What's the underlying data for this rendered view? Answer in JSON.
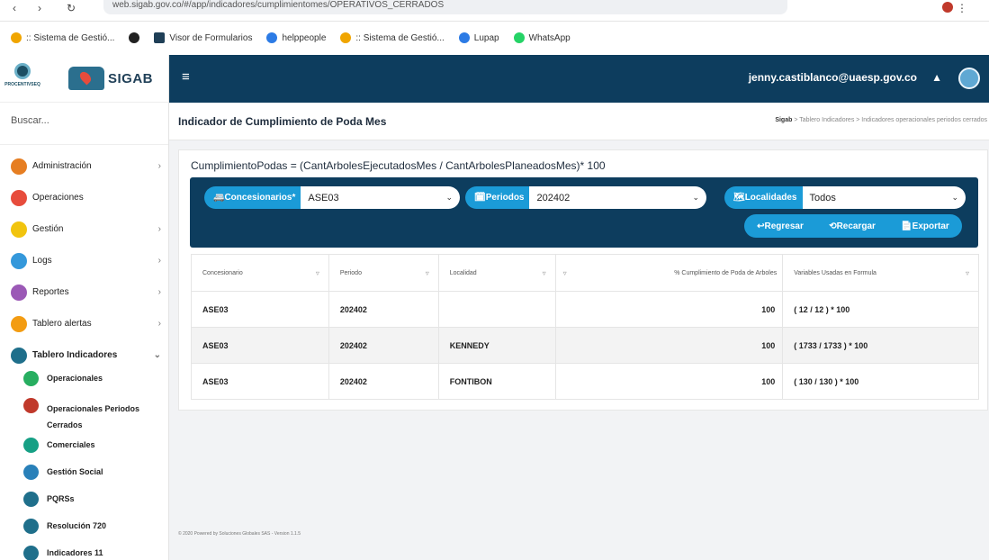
{
  "browser": {
    "url": "web.sigab.gov.co/#/app/indicadores/cumplimientomes/OPERATIVOS_CERRADOS",
    "bookmarks": [
      {
        "label": ":: Sistema de Gestió...",
        "color": "#f0a500"
      },
      {
        "label": "",
        "color": "#222222"
      },
      {
        "label": "Visor de Formularios",
        "color": "#1f3f57"
      },
      {
        "label": "helppeople",
        "color": "#2c7be5"
      },
      {
        "label": ":: Sistema de Gestió...",
        "color": "#f0a500"
      },
      {
        "label": "Lupap",
        "color": "#2c7be5"
      },
      {
        "label": "WhatsApp",
        "color": "#25d366"
      }
    ]
  },
  "brand": {
    "logo_small": "PROCENTIVSEQ",
    "name": "SIGAB"
  },
  "sidebar": {
    "search_placeholder": "Buscar...",
    "items": [
      {
        "label": "Administración",
        "chevron": "›",
        "color": "#e67e22"
      },
      {
        "label": "Operaciones",
        "chevron": "",
        "color": "#e74c3c"
      },
      {
        "label": "Gestión",
        "chevron": "›",
        "color": "#f1c40f"
      },
      {
        "label": "Logs",
        "chevron": "›",
        "color": "#3498db"
      },
      {
        "label": "Reportes",
        "chevron": "›",
        "color": "#9b59b6"
      },
      {
        "label": "Tablero alertas",
        "chevron": "›",
        "color": "#f39c12"
      },
      {
        "label": "Tablero Indicadores",
        "chevron": "⌄",
        "color": "#1f6f8b"
      }
    ],
    "subitems": [
      {
        "label": "Operacionales",
        "color": "#27ae60"
      },
      {
        "label": "Operacionales Periodos Cerrados",
        "color": "#c0392b"
      },
      {
        "label": "Comerciales",
        "color": "#16a085"
      },
      {
        "label": "Gestión Social",
        "color": "#2980b9"
      },
      {
        "label": "PQRSs",
        "color": "#1f6f8b"
      },
      {
        "label": "Resolución 720",
        "color": "#1f6f8b"
      },
      {
        "label": "Indicadores 11",
        "color": "#1f6f8b"
      }
    ]
  },
  "topbar": {
    "menu_icon": "≡",
    "user": "jenny.castiblanco@uaesp.gov.co",
    "bell": "🔔"
  },
  "page": {
    "title": "Indicador de Cumplimiento de Poda Mes",
    "breadcrumb_root": "Sigab",
    "breadcrumb_rest": " > Tablero Indicadores > Indicadores operacionales periodos cerrados"
  },
  "formula": "CumplimientoPodas = (CantArbolesEjecutadosMes / CantArbolesPlaneadosMes)* 100",
  "filters": {
    "concesionario_label": "🚐Concesionarios*",
    "concesionario_value": "ASE03",
    "periodo_label": "🗓Periodos",
    "periodo_value": "202402",
    "localidad_label": "🗺Localidades",
    "localidad_value": "Todos",
    "regresar": "↩Regresar",
    "recargar": "⟲Recargar",
    "exportar": "📄Exportar"
  },
  "table": {
    "headers": [
      "Concesionario",
      "Periodo",
      "Localidad",
      "",
      "% Cumplimiento de Poda de Arboles",
      "Variables Usadas en Formula"
    ],
    "rows": [
      [
        "ASE03",
        "202402",
        "",
        "",
        "100",
        "( 12 / 12 ) * 100"
      ],
      [
        "ASE03",
        "202402",
        "KENNEDY",
        "",
        "100",
        "( 1733 / 1733 ) * 100"
      ],
      [
        "ASE03",
        "202402",
        "FONTIBON",
        "",
        "100",
        "( 130 / 130 ) * 100"
      ]
    ]
  },
  "footer": "© 2020 Powered by Soluciones Globales SAS - Version 1.1.5"
}
